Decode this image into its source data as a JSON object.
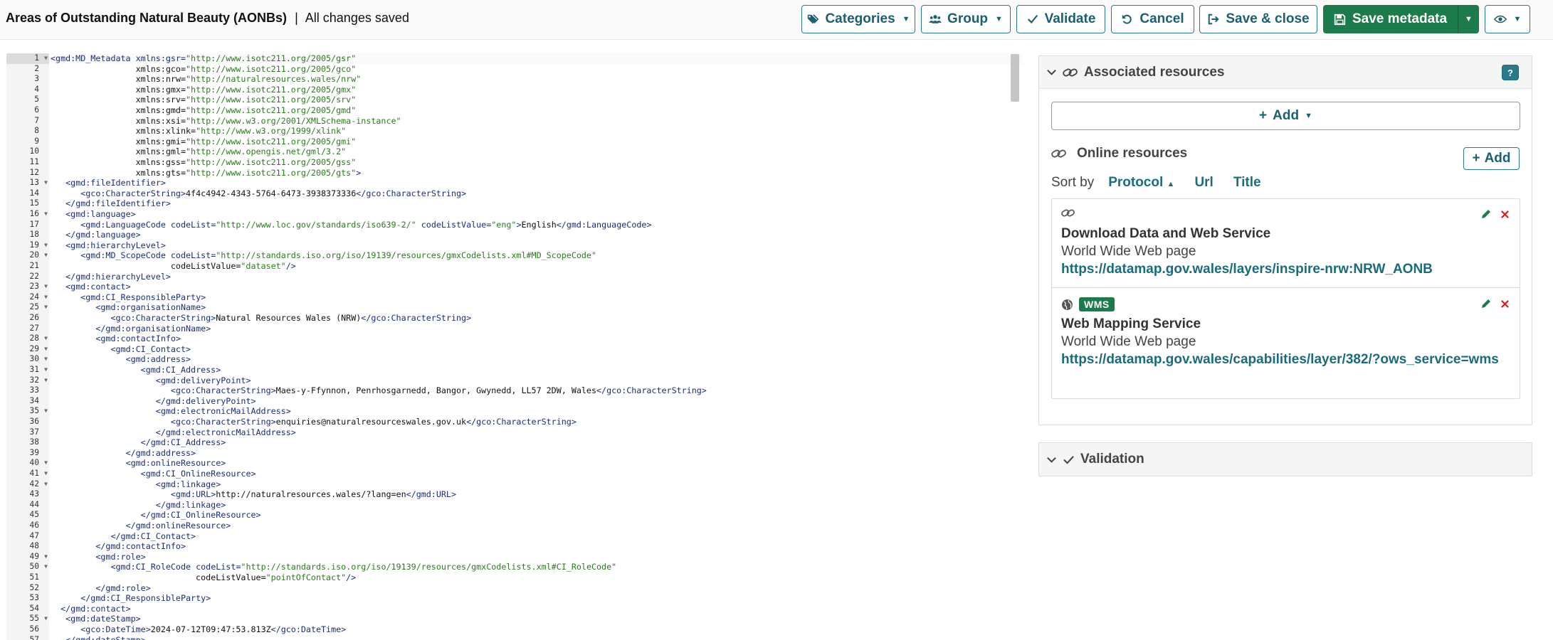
{
  "header": {
    "record_title": "Areas of Outstanding Natural Beauty (AONBs)",
    "separator": "|",
    "save_status": "All changes saved"
  },
  "toolbar": {
    "categories_label": "Categories",
    "group_label": "Group",
    "validate_label": "Validate",
    "cancel_label": "Cancel",
    "save_close_label": "Save & close",
    "save_metadata_label": "Save metadata"
  },
  "editor": {
    "lines": [
      {
        "n": "1",
        "code": "<gmd:MD_Metadata xmlns:gsr=\"http://www.isotc211.org/2005/gsr\"",
        "fold": true
      },
      {
        "n": "2",
        "code": "                 xmlns:gco=\"http://www.isotc211.org/2005/gco\""
      },
      {
        "n": "3",
        "code": "                 xmlns:nrw=\"http://naturalresources.wales/nrw\""
      },
      {
        "n": "4",
        "code": "                 xmlns:gmx=\"http://www.isotc211.org/2005/gmx\""
      },
      {
        "n": "5",
        "code": "                 xmlns:srv=\"http://www.isotc211.org/2005/srv\""
      },
      {
        "n": "6",
        "code": "                 xmlns:gmd=\"http://www.isotc211.org/2005/gmd\""
      },
      {
        "n": "7",
        "code": "                 xmlns:xsi=\"http://www.w3.org/2001/XMLSchema-instance\""
      },
      {
        "n": "8",
        "code": "                 xmlns:xlink=\"http://www.w3.org/1999/xlink\""
      },
      {
        "n": "9",
        "code": "                 xmlns:gmi=\"http://www.isotc211.org/2005/gmi\""
      },
      {
        "n": "10",
        "code": "                 xmlns:gml=\"http://www.opengis.net/gml/3.2\""
      },
      {
        "n": "11",
        "code": "                 xmlns:gss=\"http://www.isotc211.org/2005/gss\""
      },
      {
        "n": "12",
        "code": "                 xmlns:gts=\"http://www.isotc211.org/2005/gts\">"
      },
      {
        "n": "13",
        "code": "   <gmd:fileIdentifier>",
        "fold": true
      },
      {
        "n": "14",
        "code": "      <gco:CharacterString>4f4c4942-4343-5764-6473-3938373336</gco:CharacterString>"
      },
      {
        "n": "15",
        "code": "   </gmd:fileIdentifier>"
      },
      {
        "n": "16",
        "code": "   <gmd:language>",
        "fold": true
      },
      {
        "n": "17",
        "code": "      <gmd:LanguageCode codeList=\"http://www.loc.gov/standards/iso639-2/\" codeListValue=\"eng\">English</gmd:LanguageCode>"
      },
      {
        "n": "18",
        "code": "   </gmd:language>"
      },
      {
        "n": "19",
        "code": "   <gmd:hierarchyLevel>",
        "fold": true
      },
      {
        "n": "20",
        "code": "      <gmd:MD_ScopeCode codeList=\"http://standards.iso.org/iso/19139/resources/gmxCodelists.xml#MD_ScopeCode\"",
        "fold": true
      },
      {
        "n": "21",
        "code": "                        codeListValue=\"dataset\"/>"
      },
      {
        "n": "22",
        "code": "   </gmd:hierarchyLevel>"
      },
      {
        "n": "23",
        "code": "   <gmd:contact>",
        "fold": true
      },
      {
        "n": "24",
        "code": "      <gmd:CI_ResponsibleParty>",
        "fold": true
      },
      {
        "n": "25",
        "code": "         <gmd:organisationName>",
        "fold": true
      },
      {
        "n": "26",
        "code": "            <gco:CharacterString>Natural Resources Wales (NRW)</gco:CharacterString>"
      },
      {
        "n": "27",
        "code": "         </gmd:organisationName>"
      },
      {
        "n": "28",
        "code": "         <gmd:contactInfo>",
        "fold": true
      },
      {
        "n": "29",
        "code": "            <gmd:CI_Contact>",
        "fold": true
      },
      {
        "n": "30",
        "code": "               <gmd:address>",
        "fold": true
      },
      {
        "n": "31",
        "code": "                  <gmd:CI_Address>",
        "fold": true
      },
      {
        "n": "32",
        "code": "                     <gmd:deliveryPoint>",
        "fold": true
      },
      {
        "n": "33",
        "code": "                        <gco:CharacterString>Maes-y-Ffynnon, Penrhosgarnedd, Bangor, Gwynedd, LL57 2DW, Wales</gco:CharacterString>"
      },
      {
        "n": "34",
        "code": "                     </gmd:deliveryPoint>"
      },
      {
        "n": "35",
        "code": "                     <gmd:electronicMailAddress>",
        "fold": true
      },
      {
        "n": "36",
        "code": "                        <gco:CharacterString>enquiries@naturalresourceswales.gov.uk</gco:CharacterString>"
      },
      {
        "n": "37",
        "code": "                     </gmd:electronicMailAddress>"
      },
      {
        "n": "38",
        "code": "                  </gmd:CI_Address>"
      },
      {
        "n": "39",
        "code": "               </gmd:address>"
      },
      {
        "n": "40",
        "code": "               <gmd:onlineResource>",
        "fold": true
      },
      {
        "n": "41",
        "code": "                  <gmd:CI_OnlineResource>",
        "fold": true
      },
      {
        "n": "42",
        "code": "                     <gmd:linkage>",
        "fold": true
      },
      {
        "n": "43",
        "code": "                        <gmd:URL>http://naturalresources.wales/?lang=en</gmd:URL>"
      },
      {
        "n": "44",
        "code": "                     </gmd:linkage>"
      },
      {
        "n": "45",
        "code": "                  </gmd:CI_OnlineResource>"
      },
      {
        "n": "46",
        "code": "               </gmd:onlineResource>"
      },
      {
        "n": "47",
        "code": "            </gmd:CI_Contact>"
      },
      {
        "n": "48",
        "code": "         </gmd:contactInfo>"
      },
      {
        "n": "49",
        "code": "         <gmd:role>",
        "fold": true
      },
      {
        "n": "50",
        "code": "            <gmd:CI_RoleCode codeList=\"http://standards.iso.org/iso/19139/resources/gmxCodelists.xml#CI_RoleCode\"",
        "fold": true
      },
      {
        "n": "51",
        "code": "                             codeListValue=\"pointOfContact\"/>"
      },
      {
        "n": "52",
        "code": "         </gmd:role>"
      },
      {
        "n": "53",
        "code": "      </gmd:CI_ResponsibleParty>"
      },
      {
        "n": "54",
        "code": "  </gmd:contact>"
      },
      {
        "n": "55",
        "code": "   <gmd:dateStamp>",
        "fold": true
      },
      {
        "n": "56",
        "code": "      <gco:DateTime>2024-07-12T09:47:53.813Z</gco:DateTime>"
      },
      {
        "n": "57",
        "code": "   </gmd:dateStamp>"
      }
    ]
  },
  "associated_resources": {
    "title": "Associated resources",
    "help": "?",
    "add_label": "Add",
    "online_resources": {
      "title": "Online resources",
      "add_label": "Add",
      "sort_by_label": "Sort by",
      "sort_options": [
        "Protocol",
        "Url",
        "Title"
      ],
      "items": [
        {
          "badge": "",
          "title": "Download Data and Web Service",
          "description": "World Wide Web page",
          "url": "https://datamap.gov.wales/layers/inspire-nrw:NRW_AONB"
        },
        {
          "badge": "WMS",
          "title": "Web Mapping Service",
          "description": "World Wide Web page",
          "url": "https://datamap.gov.wales/capabilities/layer/382/?ows_service=wms"
        }
      ]
    }
  },
  "validation": {
    "title": "Validation"
  },
  "colors": {
    "accent": "#1a6e80",
    "save_green": "#1b7b4a",
    "delete_red": "#cc2222"
  }
}
